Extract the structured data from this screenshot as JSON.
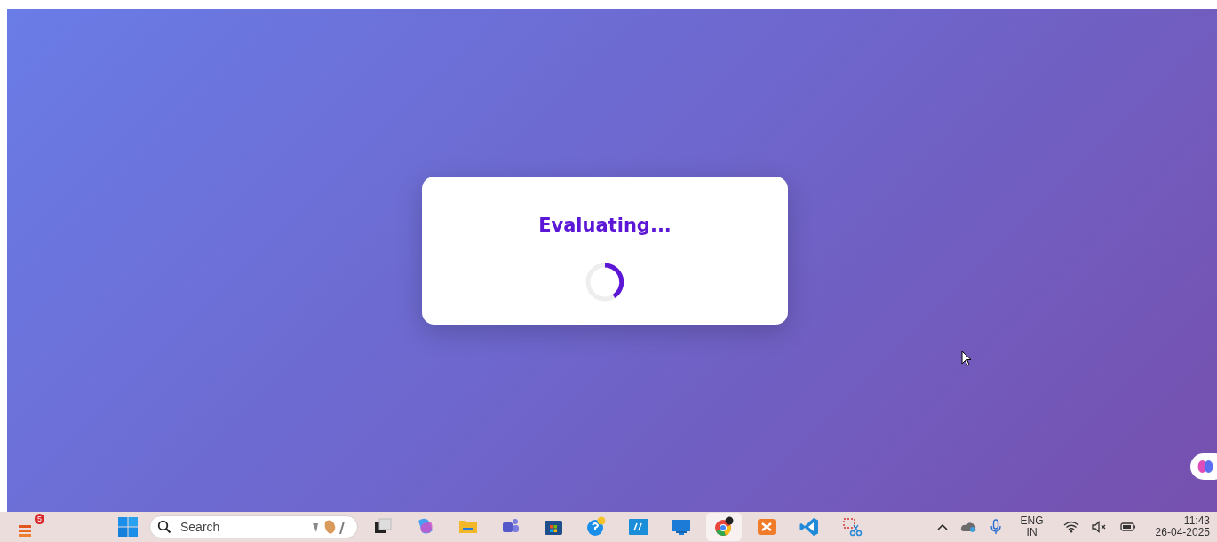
{
  "dialog": {
    "title": "Evaluating..."
  },
  "taskbar": {
    "widget_badge": "5",
    "search": {
      "placeholder": "Search"
    },
    "apps": [
      {
        "kind": "taskview",
        "selected": false
      },
      {
        "kind": "copilot",
        "selected": false
      },
      {
        "kind": "folder",
        "selected": false
      },
      {
        "kind": "teams",
        "selected": false
      },
      {
        "kind": "store",
        "selected": false
      },
      {
        "kind": "help",
        "selected": false
      },
      {
        "kind": "hp",
        "selected": false
      },
      {
        "kind": "monitor",
        "selected": false
      },
      {
        "kind": "chrome",
        "selected": true
      },
      {
        "kind": "xampp",
        "selected": false
      },
      {
        "kind": "vscode",
        "selected": false
      },
      {
        "kind": "snip",
        "selected": false
      }
    ],
    "tray": {
      "language": "ENG",
      "region": "IN",
      "time": "11:43",
      "date": "26-04-2025"
    }
  }
}
